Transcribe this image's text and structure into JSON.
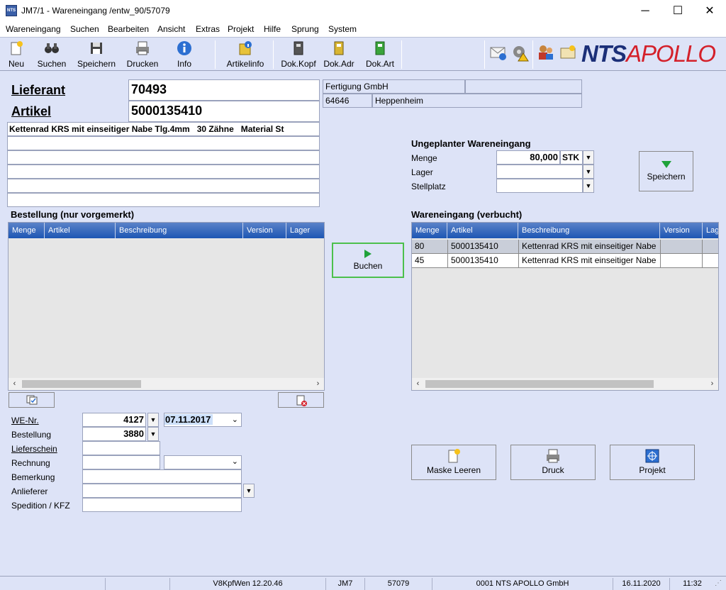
{
  "window": {
    "title": "JM7/1 - Wareneingang /entw_90/57079",
    "app_icon_text": "NTS",
    "minimize": "─",
    "maximize": "☐",
    "close": "✕"
  },
  "menu": [
    "Wareneingang",
    "Suchen",
    "Bearbeiten",
    "Ansicht",
    "Extras",
    "Projekt",
    "Hilfe",
    "Sprung",
    "System"
  ],
  "toolbar": {
    "neu": "Neu",
    "suchen": "Suchen",
    "speichern": "Speichern",
    "drucken": "Drucken",
    "info": "Info",
    "artikelinfo": "Artikelinfo",
    "dok_kopf": "Dok.Kopf",
    "dok_adr": "Dok.Adr",
    "dok_art": "Dok.Art",
    "brand_nts": "NTS",
    "brand_apollo": "APOLLO"
  },
  "header": {
    "lieferant_label": "Lieferant",
    "lieferant_value": "70493",
    "artikel_label": "Artikel",
    "artikel_value": "5000135410",
    "description": "Kettenrad KRS mit einseitiger Nabe Tlg.4mm   30 Zähne   Material St",
    "supplier_name": "Fertigung GmbH",
    "supplier_zip": "64646",
    "supplier_city": "Heppenheim"
  },
  "ungeplant": {
    "title": "Ungeplanter Wareneingang",
    "menge_label": "Menge",
    "menge_value": "80,000",
    "unit": "STK",
    "lager_label": "Lager",
    "stellplatz_label": "Stellplatz",
    "speichern": "Speichern"
  },
  "bestellung": {
    "title": "Bestellung (nur vorgemerkt)",
    "columns": [
      "Menge",
      "Artikel",
      "Beschreibung",
      "Version",
      "Lager"
    ]
  },
  "buchen": "Buchen",
  "wareneingang": {
    "title": "Wareneingang (verbucht)",
    "columns": [
      "Menge",
      "Artikel",
      "Beschreibung",
      "Version",
      "Lag"
    ],
    "rows": [
      {
        "menge": "80",
        "artikel": "5000135410",
        "beschreibung": "Kettenrad KRS mit einseitiger Nabe",
        "version": "",
        "lager": ""
      },
      {
        "menge": "45",
        "artikel": "5000135410",
        "beschreibung": "Kettenrad KRS mit einseitiger Nabe",
        "version": "",
        "lager": ""
      }
    ]
  },
  "form": {
    "we_nr_label": "WE-Nr.",
    "we_nr_value": "4127",
    "we_date": "07.11.2017",
    "bestellung_label": "Bestellung",
    "bestellung_value": "3880",
    "lieferschein_label": "Lieferschein",
    "rechnung_label": "Rechnung",
    "bemerkung_label": "Bemerkung",
    "anlieferer_label": "Anlieferer",
    "spedition_label": "Spedition / KFZ"
  },
  "actions": {
    "maske_leeren": "Maske Leeren",
    "druck": "Druck",
    "projekt": "Projekt"
  },
  "status": {
    "version": "V8KpfWen 12.20.46",
    "module": "JM7",
    "session": "57079",
    "company": "0001 NTS APOLLO GmbH",
    "date": "16.11.2020",
    "time": "11:32"
  }
}
